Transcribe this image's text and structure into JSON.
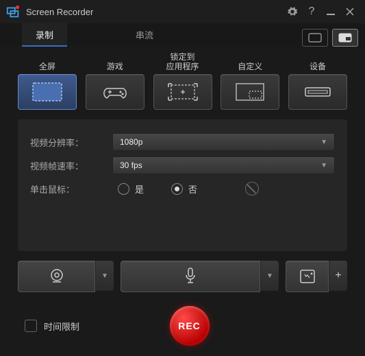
{
  "app": {
    "title": "Screen Recorder"
  },
  "tabs": {
    "record": "录制",
    "stream": "串流"
  },
  "modes": {
    "fullscreen": "全屏",
    "game": "游戏",
    "lockapp": "锁定到\n应用程序",
    "custom": "自定义",
    "device": "设备"
  },
  "settings": {
    "res_label": "视频分辨率：",
    "res_value": "1080p",
    "fps_label": "视频帧速率：",
    "fps_value": "30 fps",
    "click_label": "单击鼠标：",
    "yes": "是",
    "no": "否"
  },
  "bottom": {
    "timelimit": "时间限制",
    "rec": "REC"
  }
}
